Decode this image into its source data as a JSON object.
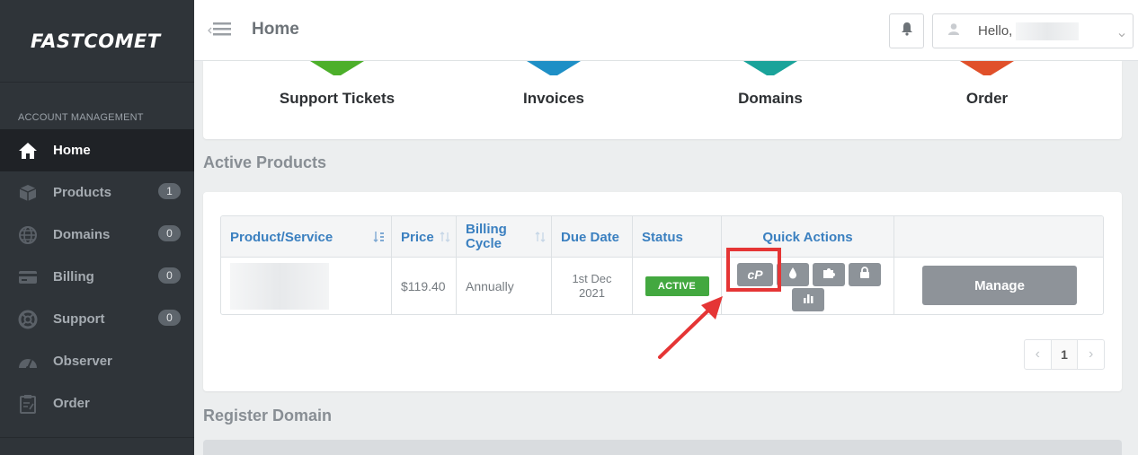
{
  "brand": {
    "logo_text": "FASTCOMET"
  },
  "sidebar": {
    "section_title": "ACCOUNT MANAGEMENT",
    "items": [
      {
        "label": "Home",
        "icon": "home-icon",
        "active": true,
        "badge": null
      },
      {
        "label": "Products",
        "icon": "cube-icon",
        "badge": "1"
      },
      {
        "label": "Domains",
        "icon": "globe-icon",
        "badge": "0"
      },
      {
        "label": "Billing",
        "icon": "credit-card-icon",
        "badge": "0"
      },
      {
        "label": "Support",
        "icon": "lifebuoy-icon",
        "badge": "0"
      },
      {
        "label": "Observer",
        "icon": "dashboard-icon",
        "badge": null
      },
      {
        "label": "Order",
        "icon": "clipboard-icon",
        "badge": null
      }
    ]
  },
  "topbar": {
    "title": "Home",
    "user_greeting": "Hello,"
  },
  "shortcuts": [
    {
      "label": "Support Tickets",
      "color": "#4caf2a"
    },
    {
      "label": "Invoices",
      "color": "#1e8fc6"
    },
    {
      "label": "Domains",
      "color": "#1aa39a"
    },
    {
      "label": "Order",
      "color": "#e0502a"
    }
  ],
  "active_products": {
    "heading": "Active Products",
    "columns": [
      "Product/Service",
      "Price",
      "Billing Cycle",
      "Due Date",
      "Status",
      "Quick Actions"
    ],
    "rows": [
      {
        "price": "$119.40",
        "billing_cycle": "Annually",
        "due_date": "1st Dec 2021",
        "status": "ACTIVE"
      }
    ],
    "quick_actions": [
      "cpanel-icon",
      "droplet-icon",
      "puzzle-icon",
      "lock-icon",
      "bar-chart-icon"
    ],
    "quick_action_text": "cP",
    "manage_label": "Manage",
    "pagination": {
      "prev": "‹",
      "current": "1",
      "next": "›"
    }
  },
  "register_domain": {
    "heading": "Register Domain"
  },
  "colors": {
    "sidebar_bg": "#2f3439",
    "link_blue": "#3b80c0",
    "status_green": "#43a840",
    "highlight_red": "#e53535"
  }
}
